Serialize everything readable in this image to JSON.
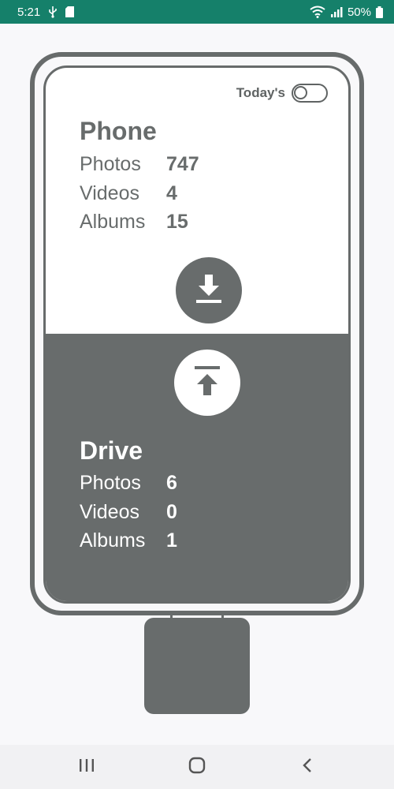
{
  "status_bar": {
    "time": "5:21",
    "battery": "50%"
  },
  "toggle": {
    "label": "Today's",
    "state": "off"
  },
  "phone": {
    "title": "Phone",
    "stats": [
      {
        "label": "Photos",
        "value": "747"
      },
      {
        "label": "Videos",
        "value": "4"
      },
      {
        "label": "Albums",
        "value": "15"
      }
    ]
  },
  "drive": {
    "title": "Drive",
    "stats": [
      {
        "label": "Photos",
        "value": "6"
      },
      {
        "label": "Videos",
        "value": "0"
      },
      {
        "label": "Albums",
        "value": "1"
      }
    ]
  },
  "icons": {
    "download": "download-to-phone-icon",
    "upload": "upload-to-drive-icon",
    "recents": "recent-apps-icon",
    "home": "home-icon",
    "back": "back-icon"
  },
  "colors": {
    "status_bar": "#15806a",
    "primary_gray": "#686c6c",
    "background": "#f8f8fa"
  }
}
